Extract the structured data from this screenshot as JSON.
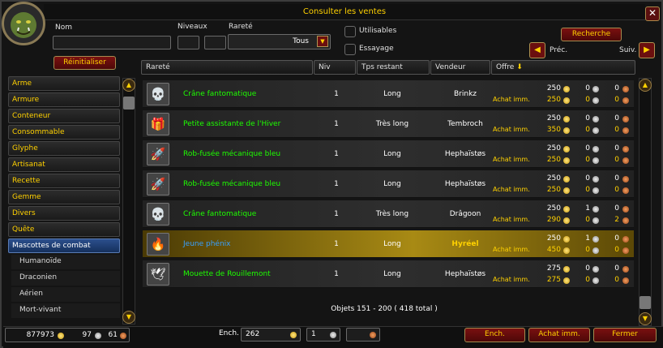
{
  "window": {
    "title": "Consulter les ventes",
    "close_glyph": "✕"
  },
  "filters": {
    "name_label": "Nom",
    "name_value": "",
    "levels_label": "Niveaux",
    "level_min": "",
    "level_max": "",
    "rarity_label": "Rareté",
    "rarity_value": "Tous",
    "usable_label": "Utilisables",
    "preview_label": "Essayage",
    "reset_label": "Réinitialiser",
    "search_label": "Recherche",
    "prev_label": "Préc.",
    "next_label": "Suiv.",
    "prev_glyph": "◀",
    "next_glyph": "▶",
    "dropdown_glyph": "▼"
  },
  "categories": {
    "items": [
      "Arme",
      "Armure",
      "Conteneur",
      "Consommable",
      "Glyphe",
      "Artisanat",
      "Recette",
      "Gemme",
      "Divers",
      "Quête",
      "Mascottes de combat"
    ],
    "selected": "Mascottes de combat",
    "subitems": [
      "Humanoïde",
      "Draconien",
      "Aérien",
      "Mort-vivant"
    ]
  },
  "columns": {
    "rarity": "Rareté",
    "level": "Niv",
    "time": "Tps restant",
    "seller": "Vendeur",
    "bid": "Offre",
    "sort_glyph": "⬇"
  },
  "listings": [
    {
      "name": "Crâne fantomatique",
      "quality": "uncommon",
      "icon": "skull-icon",
      "glyph": "💀",
      "level": "1",
      "time": "Long",
      "seller": "Brinkz",
      "bid": [
        "250",
        "0",
        "0"
      ],
      "buyout": [
        "250",
        "0",
        "0"
      ],
      "buyout_label": "Achat imm."
    },
    {
      "name": "Petite assistante de l'Hiver",
      "quality": "uncommon",
      "icon": "gift-icon",
      "glyph": "🎁",
      "level": "1",
      "time": "Très long",
      "seller": "Tembroch",
      "bid": [
        "250",
        "0",
        "0"
      ],
      "buyout": [
        "350",
        "0",
        "0"
      ],
      "buyout_label": "Achat imm."
    },
    {
      "name": "Rob-fusée mécanique bleu",
      "quality": "uncommon",
      "icon": "rocket-robot-icon",
      "glyph": "🚀",
      "level": "1",
      "time": "Long",
      "seller": "Hephaïstøs",
      "bid": [
        "250",
        "0",
        "0"
      ],
      "buyout": [
        "250",
        "0",
        "0"
      ],
      "buyout_label": "Achat imm."
    },
    {
      "name": "Rob-fusée mécanique bleu",
      "quality": "uncommon",
      "icon": "rocket-robot-icon",
      "glyph": "🚀",
      "level": "1",
      "time": "Long",
      "seller": "Hephaïstøs",
      "bid": [
        "250",
        "0",
        "0"
      ],
      "buyout": [
        "250",
        "0",
        "0"
      ],
      "buyout_label": "Achat imm."
    },
    {
      "name": "Crâne fantomatique",
      "quality": "uncommon",
      "icon": "skull-icon",
      "glyph": "💀",
      "level": "1",
      "time": "Très long",
      "seller": "Drâgoon",
      "bid": [
        "250",
        "1",
        "0"
      ],
      "buyout": [
        "290",
        "0",
        "2"
      ],
      "buyout_label": "Achat imm."
    },
    {
      "name": "Jeune phénix",
      "quality": "rare",
      "icon": "phoenix-icon",
      "glyph": "🔥",
      "level": "1",
      "time": "Long",
      "seller": "Hyréel",
      "bid": [
        "250",
        "1",
        "0"
      ],
      "buyout": [
        "450",
        "0",
        "0"
      ],
      "buyout_label": "Achat imm."
    },
    {
      "name": "Mouette de Rouillemont",
      "quality": "uncommon",
      "icon": "seagull-icon",
      "glyph": "🕊",
      "level": "1",
      "time": "Long",
      "seller": "Hephaïstøs",
      "bid": [
        "275",
        "0",
        "0"
      ],
      "buyout": [
        "275",
        "0",
        "0"
      ],
      "buyout_label": "Achat imm."
    }
  ],
  "selected_row": 5,
  "results": "Objets 151 - 200 ( 418 total )",
  "player_money": {
    "gold": "877973",
    "silver": "97",
    "copper": "61"
  },
  "bid_entry": {
    "label": "Ench.",
    "gold": "262",
    "silver": "1",
    "copper": ""
  },
  "buttons": {
    "bid": "Ench.",
    "buyout": "Achat imm.",
    "close": "Fermer"
  },
  "colors": {
    "uncommon": "#1eff00",
    "rare": "#39a0ff",
    "gold_text": "#ffd100",
    "button_red": "#6b0f0f"
  }
}
